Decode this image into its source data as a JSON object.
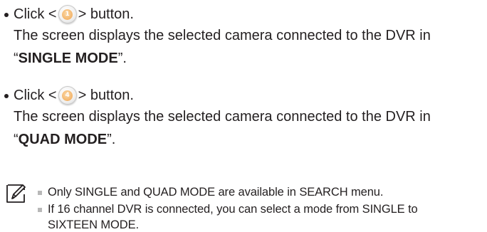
{
  "items": [
    {
      "click_prefix": "Click <",
      "button_label": "1",
      "click_suffix": "> button.",
      "desc_line1": "The screen displays the selected camera connected to the DVR in",
      "quote_open": "“",
      "mode": "SINGLE MODE",
      "quote_close": "”."
    },
    {
      "click_prefix": "Click <",
      "button_label": "4",
      "click_suffix": "> button.",
      "desc_line1": "The screen displays the selected camera connected to the DVR in",
      "quote_open": "“",
      "mode": "QUAD MODE",
      "quote_close": "”."
    }
  ],
  "notes": [
    {
      "line1": "Only SINGLE and QUAD MODE are available in SEARCH menu."
    },
    {
      "line1": "If 16 channel DVR is connected, you can select a mode from SINGLE to",
      "line2": "SIXTEEN MODE."
    }
  ],
  "icons": {
    "note": "note-pencil-icon",
    "bullet_square_color": "#b8b8b8",
    "button_accent": "#f3b46a"
  }
}
